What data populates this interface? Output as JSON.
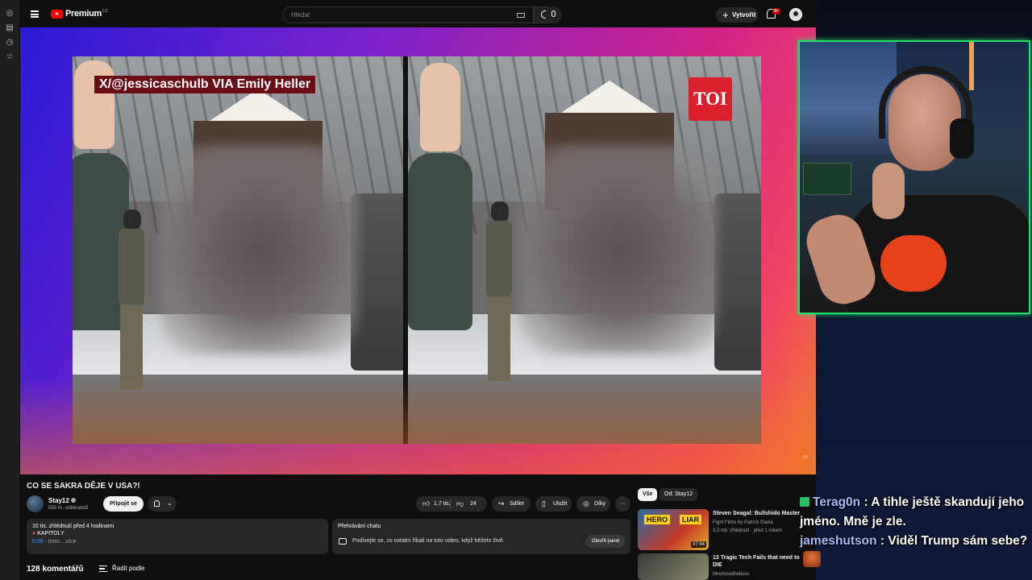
{
  "header": {
    "logo_text": "Premium",
    "logo_region": "CZ",
    "search_placeholder": "Hledat",
    "create_label": "Vytvořit",
    "notification_count": "9+"
  },
  "player": {
    "watermark_text": "X/@jessicaschulb VIA Emily Heller",
    "brand_badge": "TOI"
  },
  "video": {
    "title": "CO SE SAKRA DĚJE V USA?!",
    "channel_name": "Stay12",
    "subscribers": "559 tis. odběratelů",
    "subscribe_label": "Připojit se",
    "likes": "1,7 tis.",
    "dislikes": "24",
    "share_label": "Sdílet",
    "save_label": "Uložit",
    "thanks_label": "Díky",
    "more_label": "···"
  },
  "description": {
    "meta": "10 tis. zhlédnutí  před 4 hodinami",
    "chapters_label": "KAPITOLY",
    "timestamp": "0:00",
    "line_text": " - Intro  ...více"
  },
  "chat_replay": {
    "title": "Přehrávání chatu",
    "description": "Podívejte se, co ostatní říkali na toto video, když běželo živě.",
    "button_label": "Otevřít panel"
  },
  "comments": {
    "count_label": "128 komentářů",
    "sort_label": "Řadit podle"
  },
  "recommendations": {
    "chips": [
      "Vše",
      "Od: Stay12"
    ],
    "items": [
      {
        "title": "Steven Seagal: Bullshido Master",
        "channel": "Fight Films by Patrick Gavia",
        "meta": "3,3 mil. zhlédnutí  ·  před 1 rokem",
        "duration": "37:54",
        "thumb_text_1": "HERO",
        "thumb_text_2": "LIAR"
      },
      {
        "title": "13 Tragic Tech Fails that need to DIE",
        "channel": "Mrwhosetheboss"
      }
    ]
  },
  "stream_chat": [
    {
      "user": "Terag0n",
      "message": "A tihle ještě skandují jeho jméno. Mně je zle."
    },
    {
      "user": "jameshutson",
      "message": "Viděl Trump sám sebe?"
    }
  ],
  "colors": {
    "accent_red": "#ff0000",
    "webcam_border": "#22e06a",
    "toi_red": "#d9202c"
  }
}
